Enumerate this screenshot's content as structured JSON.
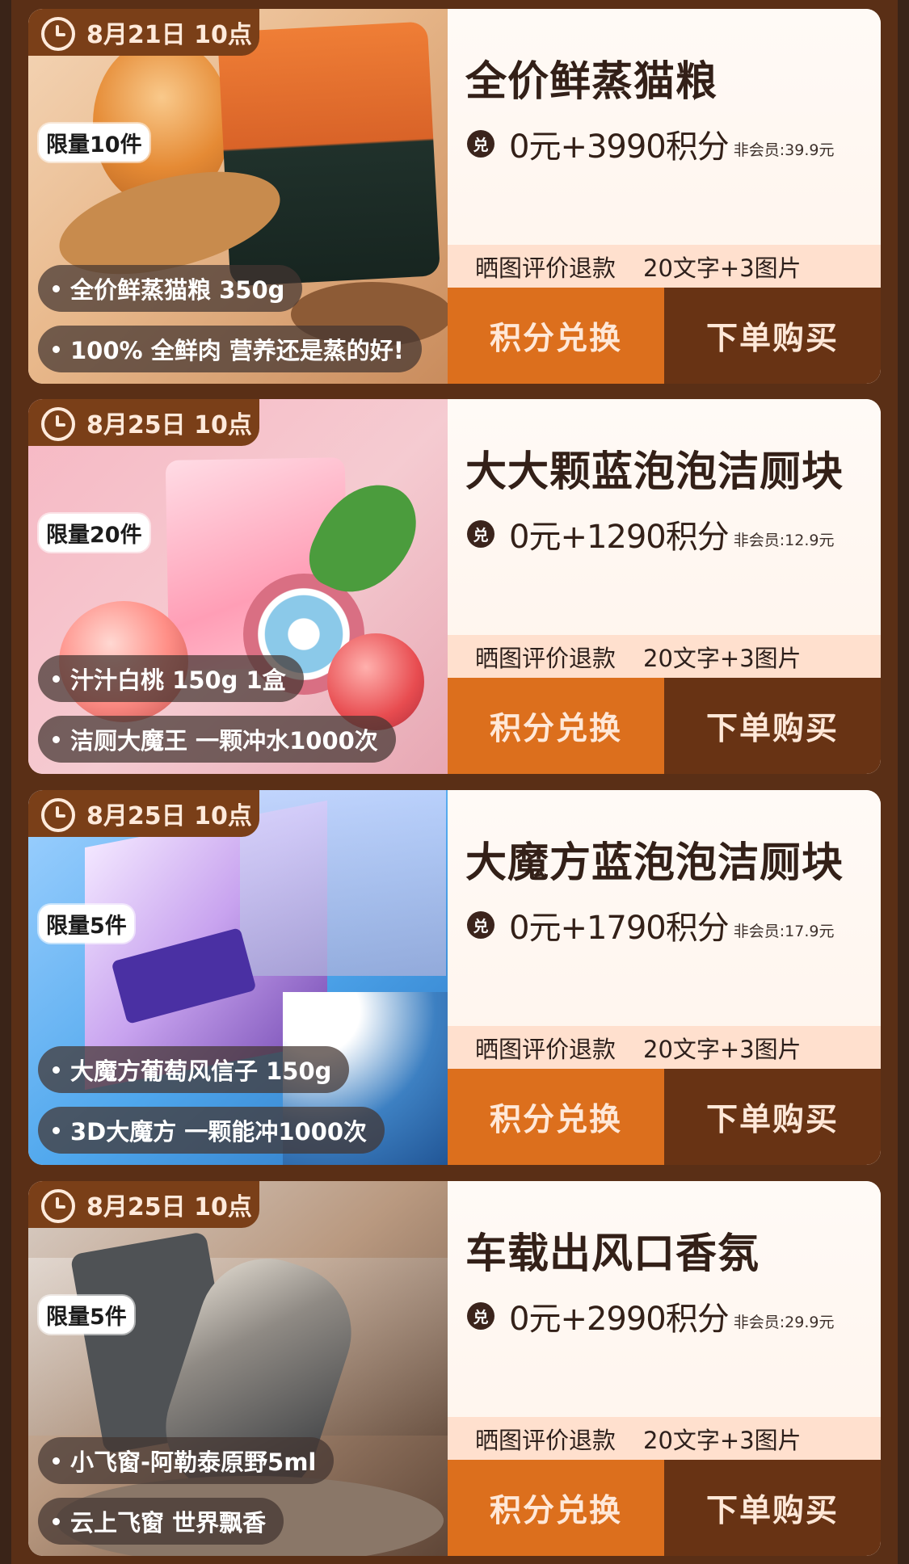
{
  "products": [
    {
      "date": "8月21日 10点",
      "limit": "限量10件",
      "points": [
        "全价鲜蒸猫粮 350g",
        "100% 全鲜肉 营养还是蒸的好!"
      ],
      "title": "全价鲜蒸猫粮",
      "price": "0元+3990积分",
      "member_price": "非会员:39.9元",
      "refund_left": "晒图评价退款",
      "refund_right": "20文字+3图片",
      "points_button": "积分兑换",
      "buy_button": "下单购买"
    },
    {
      "date": "8月25日 10点",
      "limit": "限量20件",
      "points": [
        "汁汁白桃 150g 1盒",
        "洁厕大魔王 一颗冲水1000次"
      ],
      "title": "大大颗蓝泡泡洁厕块",
      "price": "0元+1290积分",
      "member_price": "非会员:12.9元",
      "refund_left": "晒图评价退款",
      "refund_right": "20文字+3图片",
      "points_button": "积分兑换",
      "buy_button": "下单购买"
    },
    {
      "date": "8月25日 10点",
      "limit": "限量5件",
      "points": [
        "大魔方葡萄风信子 150g",
        "3D大魔方 一颗能冲1000次"
      ],
      "title": "大魔方蓝泡泡洁厕块",
      "price": "0元+1790积分",
      "member_price": "非会员:17.9元",
      "refund_left": "晒图评价退款",
      "refund_right": "20文字+3图片",
      "points_button": "积分兑换",
      "buy_button": "下单购买"
    },
    {
      "date": "8月25日 10点",
      "limit": "限量5件",
      "points": [
        "小飞窗-阿勒泰原野5ml",
        "云上飞窗 世界飘香"
      ],
      "title": "车载出风口香氛",
      "price": "0元+2990积分",
      "member_price": "非会员:29.9元",
      "refund_left": "晒图评价退款",
      "refund_right": "20文字+3图片",
      "points_button": "积分兑换",
      "buy_button": "下单购买"
    }
  ],
  "coin_glyph": "兑",
  "colors": {
    "page_background": "#5a2f16",
    "badge": "#7a3f18",
    "points_button": "#dc6f1d",
    "buy_button": "#683314",
    "refund_band": "#ffe0ce"
  }
}
